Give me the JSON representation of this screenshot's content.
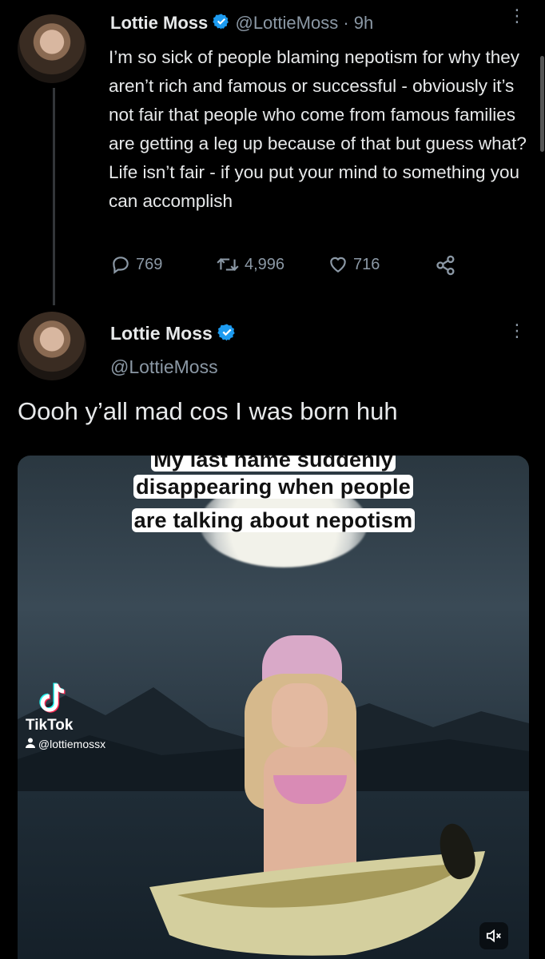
{
  "tweet1": {
    "name": "Lottie Moss",
    "handle": "@LottieMoss",
    "separator": "·",
    "time": "9h",
    "text": "I’m so sick of people blaming nepotism for why they aren’t rich and famous or successful - obviously it’s not fair that people who come from famous families are getting a leg up because of that but guess what? Life isn’t fair - if you put your mind to something you can accomplish",
    "replies": "769",
    "retweets": "4,996",
    "likes": "716"
  },
  "tweet2": {
    "name": "Lottie Moss",
    "handle": "@LottieMoss",
    "text": "Oooh y’all mad cos I was born huh",
    "media": {
      "caption_top": "My last name suddenly",
      "caption_line2": "disappearing when people",
      "caption_line3": "are talking about nepotism",
      "watermark_brand": "TikTok",
      "watermark_user": "@lottiemossx"
    }
  },
  "colors": {
    "background": "#000000",
    "text": "#e7e9ea",
    "muted": "#8b98a5",
    "verified": "#1d9bf0"
  },
  "icons": [
    "verified-badge-icon",
    "more-icon",
    "reply-icon",
    "retweet-icon",
    "like-icon",
    "share-icon",
    "tiktok-logo-icon",
    "user-icon",
    "mute-icon"
  ]
}
